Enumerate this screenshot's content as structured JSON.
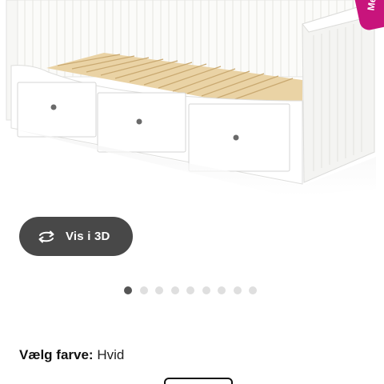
{
  "badge": {
    "label": "Me"
  },
  "view_3d": {
    "label": "Vis i 3D",
    "icon": "rotate-3d-icon"
  },
  "carousel": {
    "count": 9,
    "active_index": 0
  },
  "color": {
    "label": "Vælg farve:",
    "value": "Hvid"
  },
  "colors": {
    "badge": "#c8147c",
    "button_bg": "#484848",
    "dot_active": "#555555",
    "dot_inactive": "#dfdfdf"
  }
}
